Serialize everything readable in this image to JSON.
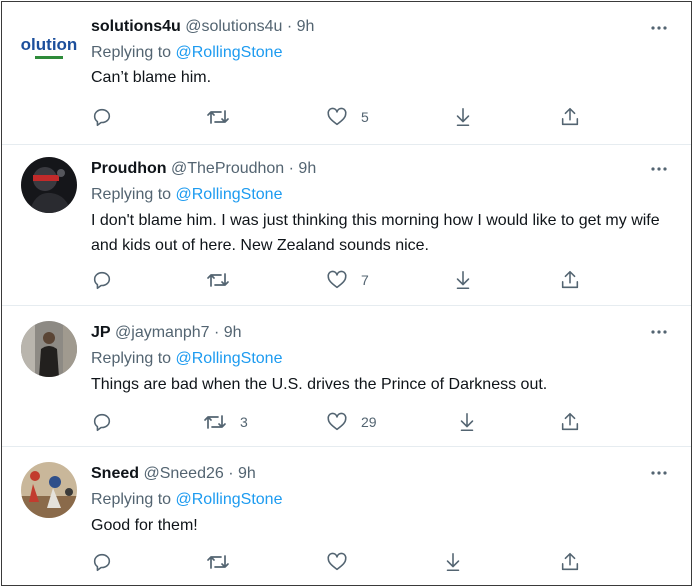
{
  "tweets": [
    {
      "name": "solutions4u",
      "handle": "@solutions4u",
      "time": "· 9h",
      "replying_prefix": "Replying to ",
      "replying_to": "@RollingStone",
      "text": "Can’t blame him.",
      "retweets": "",
      "likes": "5",
      "avatar_text": "solutions"
    },
    {
      "name": "Proudhon",
      "handle": "@TheProudhon",
      "time": "· 9h",
      "replying_prefix": "Replying to ",
      "replying_to": "@RollingStone",
      "text": "I don't blame him. I was just thinking this morning how I would like to get my wife and kids out of here. New Zealand sounds nice.",
      "retweets": "",
      "likes": "7"
    },
    {
      "name": "JP",
      "handle": "@jaymanph7",
      "time": "· 9h",
      "replying_prefix": "Replying to ",
      "replying_to": "@RollingStone",
      "text": "Things are bad when the U.S. drives the Prince of Darkness out.",
      "retweets": "3",
      "likes": "29"
    },
    {
      "name": "Sneed",
      "handle": "@Sneed26",
      "time": "· 9h",
      "replying_prefix": "Replying to ",
      "replying_to": "@RollingStone",
      "text": "Good for them!",
      "retweets": "",
      "likes": ""
    }
  ],
  "colors": {
    "secondary_text": "#536471",
    "mention": "#1d9bf0",
    "icon": "#536471",
    "divider": "#e6ecf0"
  }
}
